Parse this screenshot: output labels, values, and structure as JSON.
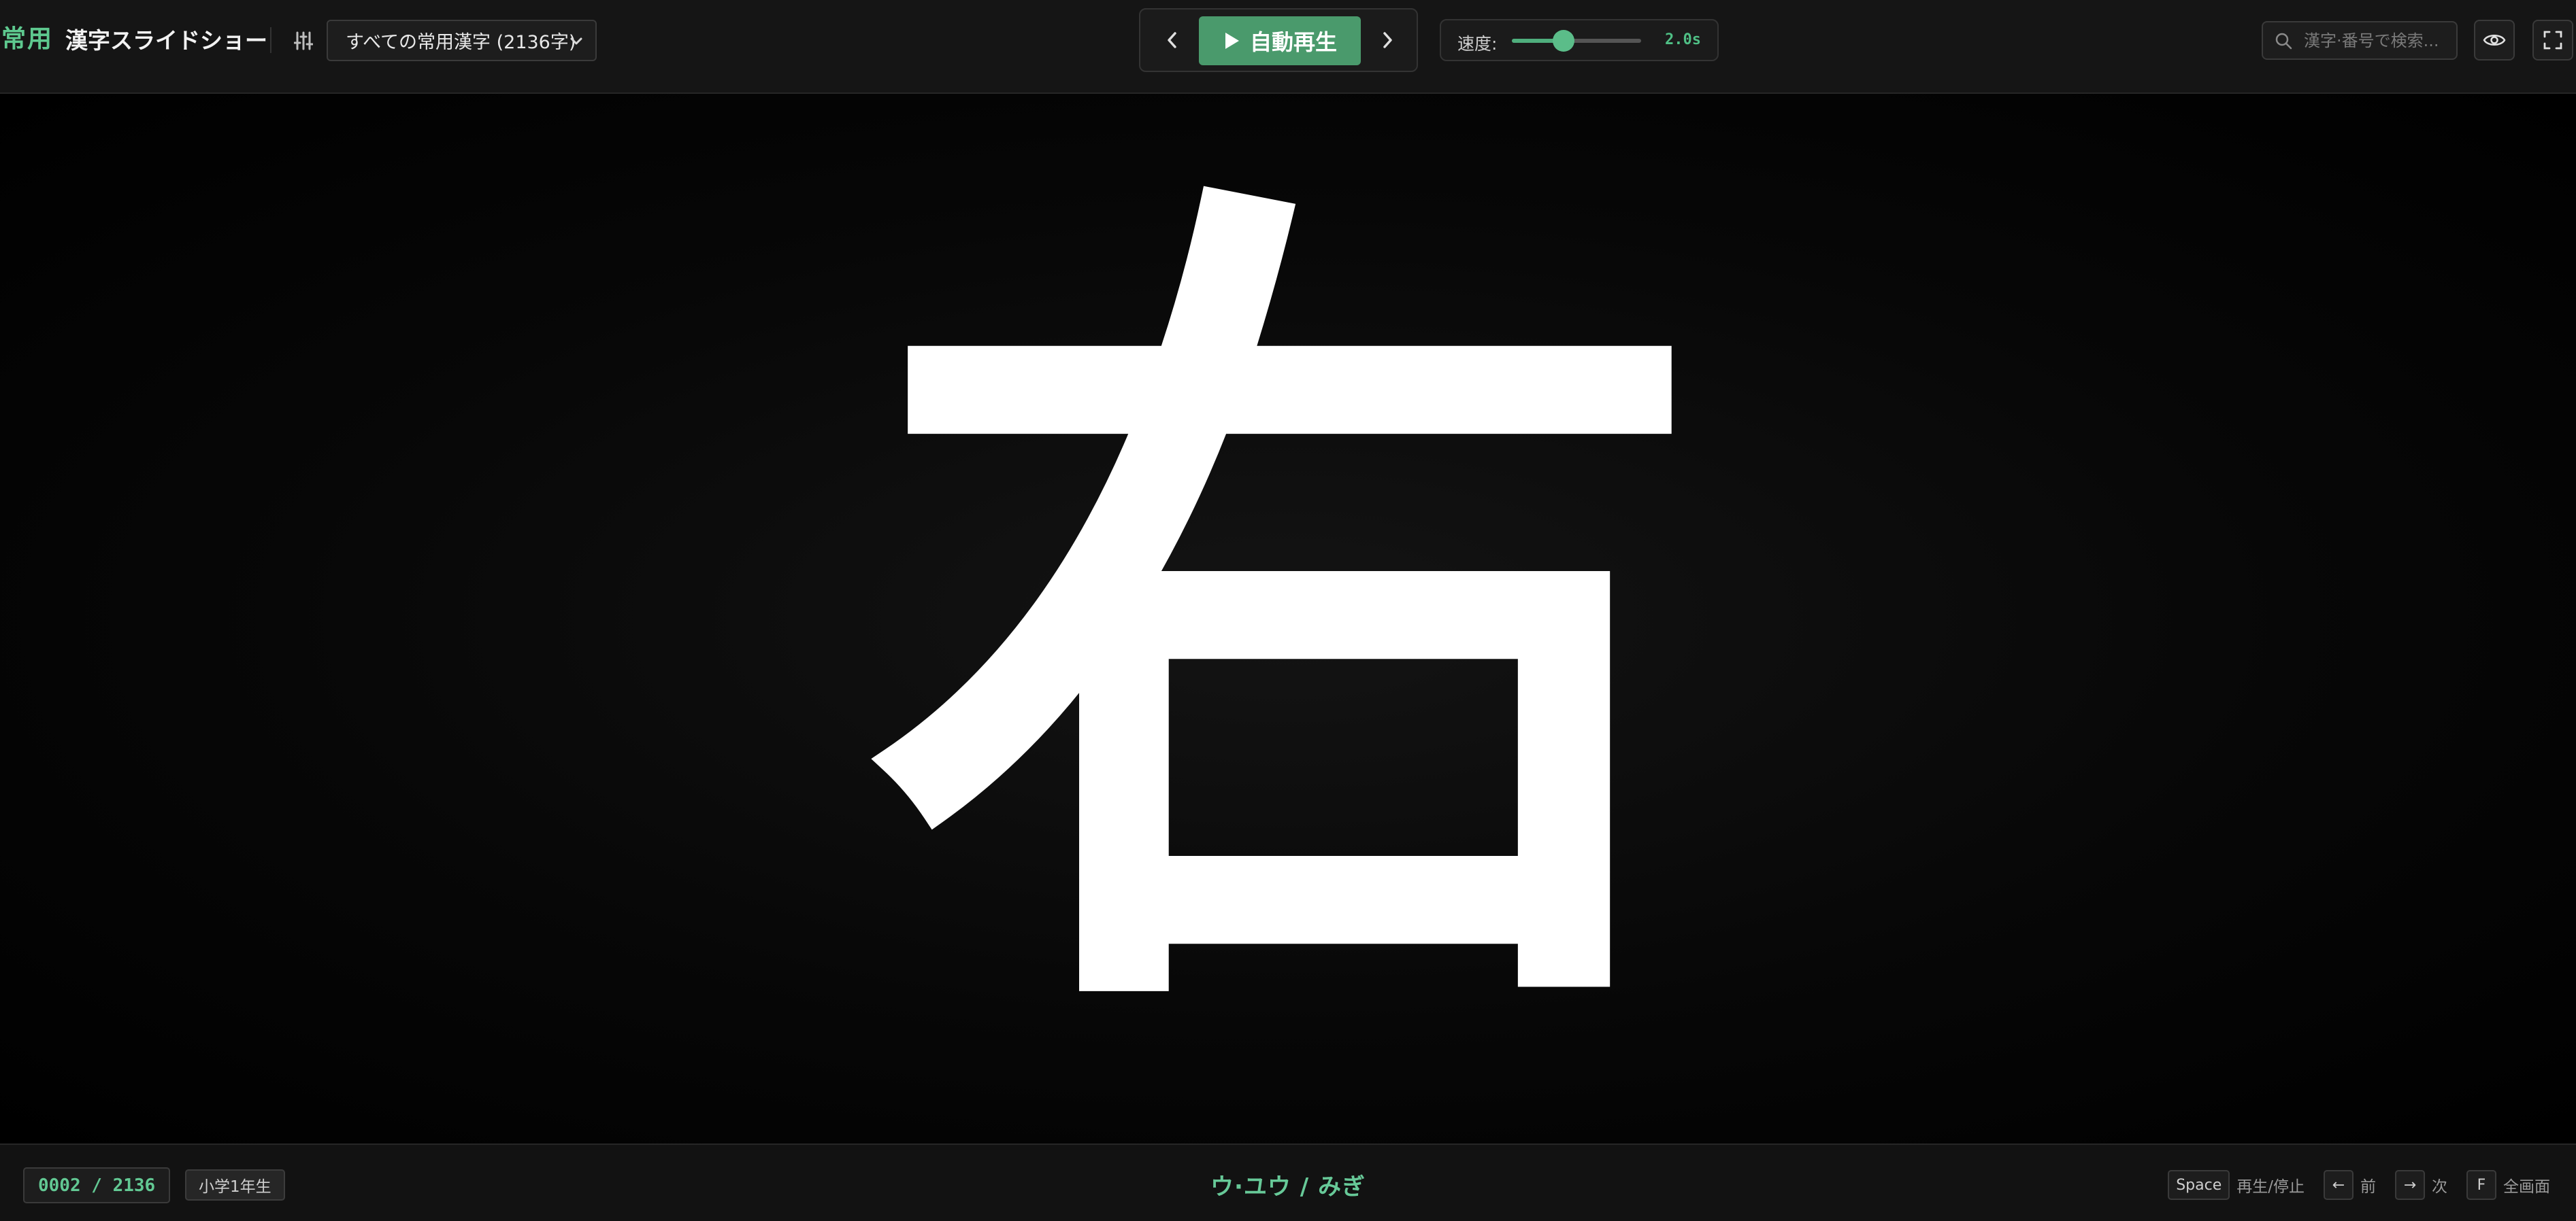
{
  "header": {
    "logo_accent": "常用",
    "title": "漢字スライドショー",
    "filter_select": {
      "selected": "すべての常用漢字 (2136字)"
    },
    "autoplay_label": "自動再生",
    "speed": {
      "label": "速度:",
      "value_text": "2.0s",
      "fraction": 0.4
    },
    "search": {
      "placeholder": "漢字·番号で検索..."
    }
  },
  "slide": {
    "kanji": "右"
  },
  "footer": {
    "counter": "0002 / 2136",
    "grade": "小学1年生",
    "reading": "ウ·ユウ / みぎ",
    "shortcuts": [
      {
        "key": "Space",
        "label": "再生/停止"
      },
      {
        "key": "←",
        "label": "前"
      },
      {
        "key": "→",
        "label": "次"
      },
      {
        "key": "F",
        "label": "全画面"
      }
    ]
  },
  "colors": {
    "accent": "#5ec98f",
    "button_green": "#4a9a6c",
    "background": "#000000",
    "bar_background": "#151515"
  },
  "icons": {
    "filter": "sliders-icon",
    "prev": "chevron-left-icon",
    "next": "chevron-right-icon",
    "play": "play-icon",
    "search": "search-icon",
    "eye": "eye-icon",
    "fullscreen": "fullscreen-icon"
  }
}
